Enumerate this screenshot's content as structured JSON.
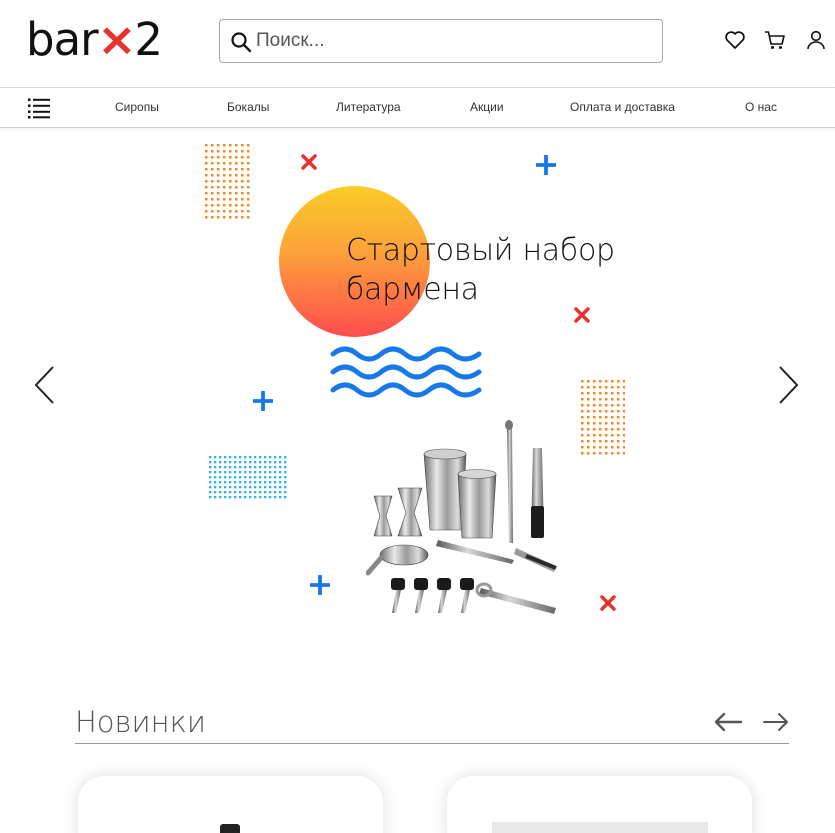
{
  "logo": {
    "part1": "bar",
    "x": "×",
    "part2": "2"
  },
  "search": {
    "placeholder": "Поиск..."
  },
  "icons": {
    "search": "search-icon",
    "favorite": "heart-icon",
    "cart": "cart-icon",
    "account": "user-icon",
    "menu": "menu-icon"
  },
  "nav": {
    "items": [
      {
        "label": "Сиропы"
      },
      {
        "label": "Бокалы"
      },
      {
        "label": "Литература"
      },
      {
        "label": "Акции"
      },
      {
        "label": "Оплата и доставка"
      },
      {
        "label": "О нас"
      }
    ]
  },
  "hero": {
    "title_line1": "Стартовый набор",
    "title_line2": "бармена"
  },
  "novinki": {
    "title": "Новинки"
  },
  "colors": {
    "accent_red": "#e8322f",
    "accent_blue": "#1778e8",
    "accent_orange": "#f08a1c",
    "accent_cyan": "#27b5f0"
  }
}
